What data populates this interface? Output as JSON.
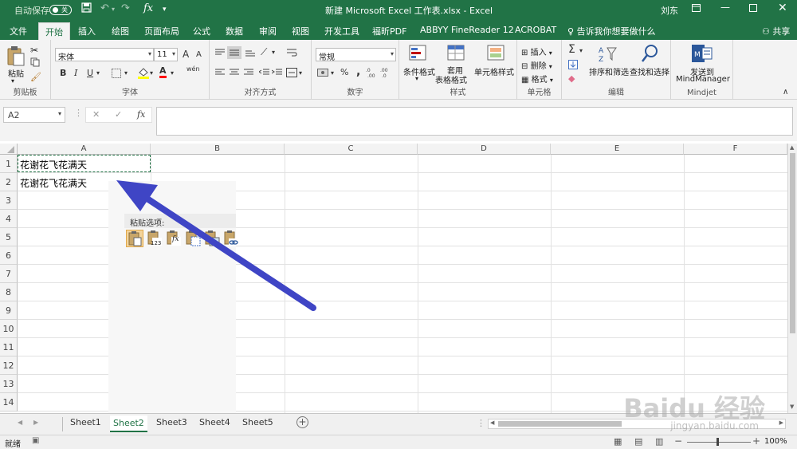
{
  "title_bar": {
    "autosave": "自动保存",
    "toggle_state": "关",
    "doc_title": "新建 Microsoft Excel 工作表.xlsx  -  Excel",
    "user": "刘东"
  },
  "tabs": [
    "文件",
    "开始",
    "插入",
    "绘图",
    "页面布局",
    "公式",
    "数据",
    "审阅",
    "视图",
    "开发工具",
    "福昕PDF",
    "ABBYY FineReader 12",
    "ACROBAT"
  ],
  "tell_me": "告诉我你想要做什么",
  "share": "共享",
  "ribbon": {
    "clipboard": {
      "label": "剪贴板",
      "paste": "粘贴"
    },
    "font": {
      "label": "字体",
      "name": "宋体",
      "size": "11",
      "bold": "B",
      "italic": "I",
      "underline": "U",
      "grow": "A",
      "shrink": "A",
      "wen": "wén",
      "font_color": "A"
    },
    "alignment": {
      "label": "对齐方式"
    },
    "number": {
      "label": "数字",
      "format": "常规",
      "percent": "%",
      "comma": ","
    },
    "styles": {
      "label": "样式",
      "conditional": "条件格式",
      "table_top": "套用",
      "table_bottom": "表格格式",
      "cell_styles": "单元格样式"
    },
    "cells": {
      "label": "单元格",
      "insert": "插入",
      "delete": "删除",
      "format": "格式"
    },
    "editing": {
      "label": "编辑",
      "sort": "排序和筛选",
      "find": "查找和选择"
    },
    "mindjet": {
      "label": "Mindjet",
      "send_line1": "发送到",
      "send_line2": "MindManager"
    }
  },
  "formula_bar": {
    "namebox": "A2",
    "fx": "fx",
    "value": ""
  },
  "columns": [
    "A",
    "B",
    "C",
    "D",
    "E",
    "F"
  ],
  "rows": [
    "1",
    "2",
    "3",
    "4",
    "5",
    "6",
    "7",
    "8",
    "9",
    "10",
    "11",
    "12",
    "13",
    "14"
  ],
  "cells": {
    "A1": "花谢花飞花满天",
    "A2": "花谢花飞花满天"
  },
  "paste_options": {
    "title": "粘贴选项:",
    "icon_123": "123",
    "icon_fx": "fx"
  },
  "sheets": [
    "Sheet1",
    "Sheet2",
    "Sheet3",
    "Sheet4",
    "Sheet5"
  ],
  "active_sheet": "Sheet2",
  "status": {
    "ready": "就绪",
    "zoom": "100%"
  },
  "watermark": {
    "main": "Baidu 经验",
    "sub": "jingyan.baidu.com"
  },
  "colors": {
    "excel_green": "#217346",
    "arrow": "#3f45c5"
  }
}
